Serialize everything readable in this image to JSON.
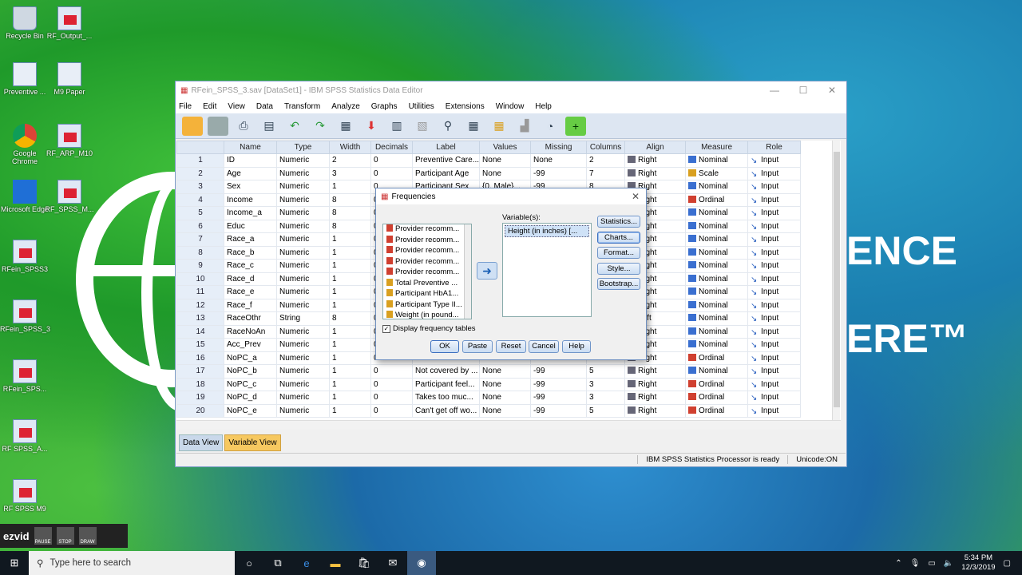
{
  "desktop": {
    "brand_text_1": "ENCE",
    "brand_text_2": "ERE™",
    "icons": [
      {
        "label": "Recycle Bin",
        "kind": "bin"
      },
      {
        "label": "RF_Output_...",
        "kind": "grid"
      },
      {
        "label": "Preventive ...",
        "kind": "doc"
      },
      {
        "label": "M9 Paper",
        "kind": "doc"
      },
      {
        "label": "Google Chrome",
        "kind": "chrome"
      },
      {
        "label": "RF_ARP_M10",
        "kind": "grid"
      },
      {
        "label": "Microsoft Edge",
        "kind": "edge"
      },
      {
        "label": "RF_SPSS_M...",
        "kind": "grid"
      },
      {
        "label": "RFein_SPSS3",
        "kind": "grid"
      },
      {
        "label": "RFein_SPSS_3",
        "kind": "grid"
      },
      {
        "label": "RFein_SPS...",
        "kind": "grid"
      },
      {
        "label": "RF SPSS_A...",
        "kind": "grid"
      },
      {
        "label": "RF SPSS M9",
        "kind": "grid"
      }
    ]
  },
  "window": {
    "title": "RFein_SPSS_3.sav [DataSet1] - IBM SPSS Statistics Data Editor",
    "menu": [
      "File",
      "Edit",
      "View",
      "Data",
      "Transform",
      "Analyze",
      "Graphs",
      "Utilities",
      "Extensions",
      "Window",
      "Help"
    ],
    "columns": [
      "Name",
      "Type",
      "Width",
      "Decimals",
      "Label",
      "Values",
      "Missing",
      "Columns",
      "Align",
      "Measure",
      "Role"
    ],
    "rows": [
      [
        "1",
        "ID",
        "Numeric",
        "2",
        "0",
        "Preventive Care...",
        "None",
        "None",
        "2",
        "Right",
        "Nominal",
        "Input"
      ],
      [
        "2",
        "Age",
        "Numeric",
        "3",
        "0",
        "Participant Age",
        "None",
        "-99",
        "7",
        "Right",
        "Scale",
        "Input"
      ],
      [
        "3",
        "Sex",
        "Numeric",
        "1",
        "0",
        "Participant Sex",
        "{0, Male}...",
        "-99",
        "8",
        "Right",
        "Nominal",
        "Input"
      ],
      [
        "4",
        "Income",
        "Numeric",
        "8",
        "0",
        "",
        "",
        "",
        "",
        "Right",
        "Ordinal",
        "Input"
      ],
      [
        "5",
        "Income_a",
        "Numeric",
        "8",
        "0",
        "",
        "",
        "",
        "",
        "Right",
        "Nominal",
        "Input"
      ],
      [
        "6",
        "Educ",
        "Numeric",
        "8",
        "0",
        "",
        "",
        "",
        "",
        "Right",
        "Nominal",
        "Input"
      ],
      [
        "7",
        "Race_a",
        "Numeric",
        "1",
        "0",
        "",
        "",
        "",
        "",
        "Right",
        "Nominal",
        "Input"
      ],
      [
        "8",
        "Race_b",
        "Numeric",
        "1",
        "0",
        "",
        "",
        "",
        "",
        "Right",
        "Nominal",
        "Input"
      ],
      [
        "9",
        "Race_c",
        "Numeric",
        "1",
        "0",
        "",
        "",
        "",
        "",
        "Right",
        "Nominal",
        "Input"
      ],
      [
        "10",
        "Race_d",
        "Numeric",
        "1",
        "0",
        "",
        "",
        "",
        "",
        "Right",
        "Nominal",
        "Input"
      ],
      [
        "11",
        "Race_e",
        "Numeric",
        "1",
        "0",
        "",
        "",
        "",
        "",
        "Right",
        "Nominal",
        "Input"
      ],
      [
        "12",
        "Race_f",
        "Numeric",
        "1",
        "0",
        "",
        "",
        "",
        "",
        "Right",
        "Nominal",
        "Input"
      ],
      [
        "13",
        "RaceOthr",
        "String",
        "8",
        "0",
        "",
        "",
        "",
        "",
        "Left",
        "Nominal",
        "Input"
      ],
      [
        "14",
        "RaceNoAn",
        "Numeric",
        "1",
        "0",
        "",
        "",
        "",
        "",
        "Right",
        "Nominal",
        "Input"
      ],
      [
        "15",
        "Acc_Prev",
        "Numeric",
        "1",
        "0",
        "",
        "",
        "",
        "",
        "Right",
        "Nominal",
        "Input"
      ],
      [
        "16",
        "NoPC_a",
        "Numeric",
        "1",
        "0",
        "",
        "",
        "",
        "",
        "Right",
        "Ordinal",
        "Input"
      ],
      [
        "17",
        "NoPC_b",
        "Numeric",
        "1",
        "0",
        "Not covered by ...",
        "None",
        "-99",
        "5",
        "Right",
        "Nominal",
        "Input"
      ],
      [
        "18",
        "NoPC_c",
        "Numeric",
        "1",
        "0",
        "Participant feel...",
        "None",
        "-99",
        "3",
        "Right",
        "Ordinal",
        "Input"
      ],
      [
        "19",
        "NoPC_d",
        "Numeric",
        "1",
        "0",
        "Takes too muc...",
        "None",
        "-99",
        "3",
        "Right",
        "Ordinal",
        "Input"
      ],
      [
        "20",
        "NoPC_e",
        "Numeric",
        "1",
        "0",
        "Can't get off wo...",
        "None",
        "-99",
        "5",
        "Right",
        "Ordinal",
        "Input"
      ]
    ],
    "tabs": {
      "data_view": "Data View",
      "variable_view": "Variable View"
    },
    "status": {
      "processor": "IBM SPSS Statistics Processor is ready",
      "unicode": "Unicode:ON"
    }
  },
  "dialog": {
    "title": "Frequencies",
    "source_items": [
      "Provider recomm...",
      "Provider recomm...",
      "Provider recomm...",
      "Provider recomm...",
      "Provider recomm...",
      "Total Preventive ...",
      "Participant HbA1...",
      "Participant Type II...",
      "Weight (in pound..."
    ],
    "variables_label": "Variable(s):",
    "selected_vars": [
      "Height (in inches) [..."
    ],
    "side_buttons": [
      "Statistics...",
      "Charts...",
      "Format...",
      "Style...",
      "Bootstrap..."
    ],
    "checkbox_label": "Display frequency tables",
    "buttons": {
      "ok": "OK",
      "paste": "Paste",
      "reset": "Reset",
      "cancel": "Cancel",
      "help": "Help"
    }
  },
  "recorder": {
    "brand": "ezvid",
    "buttons": [
      "PAUSE",
      "STOP",
      "DRAW"
    ]
  },
  "taskbar": {
    "search_placeholder": "Type here to search",
    "time": "5:34 PM",
    "date": "12/3/2019"
  }
}
